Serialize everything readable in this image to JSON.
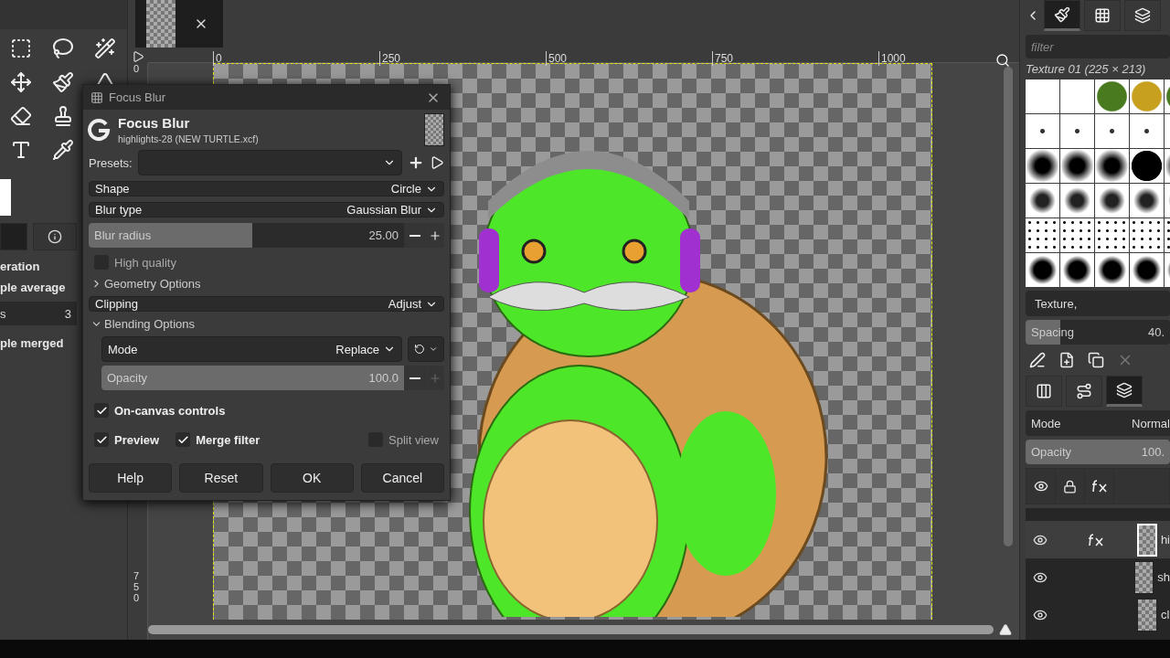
{
  "tool_options": [
    {
      "kind": "heading",
      "text": "eration"
    },
    {
      "kind": "label",
      "text": "ple average"
    },
    {
      "kind": "spin",
      "label": "s",
      "value": "3"
    },
    {
      "kind": "label",
      "text": "ple merged"
    }
  ],
  "rulers": {
    "horizontal": [
      "0",
      "250",
      "500",
      "750",
      "1000"
    ],
    "vertical": [
      "0",
      "750"
    ]
  },
  "dialog": {
    "window_title": "Focus Blur",
    "title": "Focus Blur",
    "subtitle": "highlights-28 (NEW TURTLE.xcf)",
    "presets_label": "Presets:",
    "rows": [
      {
        "kind": "combo",
        "label": "Shape",
        "value": "Circle"
      },
      {
        "kind": "combo",
        "label": "Blur type",
        "value": "Gaussian Blur"
      },
      {
        "kind": "slider",
        "label": "Blur radius",
        "value": "25.00",
        "level": 0.52
      },
      {
        "kind": "check",
        "label": "High quality",
        "checked": false
      },
      {
        "kind": "expander",
        "label": "Geometry Options",
        "expanded": false
      },
      {
        "kind": "combo",
        "label": "Clipping",
        "value": "Adjust"
      },
      {
        "kind": "expander",
        "label": "Blending Options",
        "expanded": true
      }
    ],
    "blending": {
      "mode_label": "Mode",
      "mode": "Replace",
      "opacity": {
        "label": "Opacity",
        "value": "100.0",
        "level": 1
      }
    },
    "on_canvas": {
      "label": "On-canvas controls",
      "checked": true
    },
    "preview": {
      "label": "Preview",
      "checked": true
    },
    "merge": {
      "label": "Merge filter",
      "checked": true
    },
    "split": {
      "label": "Split view",
      "checked": false
    },
    "buttons": [
      "Help",
      "Reset",
      "OK",
      "Cancel"
    ]
  },
  "brushes_panel": {
    "tabs": [
      {
        "selected": true
      },
      {
        "selected": false
      },
      {
        "selected": false
      }
    ],
    "filter_placeholder": "filter",
    "brush_name": "Texture 01 (225 × 213)",
    "tags": "Texture,",
    "spacing": {
      "label": "Spacing",
      "value": "40.",
      "level": 0.24
    }
  },
  "layers_panel": {
    "tabs": [
      {
        "selected": false
      },
      {
        "selected": false
      },
      {
        "selected": true
      }
    ],
    "mode_label": "Mode",
    "mode": "Normal",
    "opacity": {
      "label": "Opacity",
      "value": "100.",
      "level": 1
    },
    "layers": [
      {
        "name": "hi",
        "selected": true,
        "effects": true
      },
      {
        "name": "sh",
        "selected": false,
        "effects": false
      },
      {
        "name": "cl",
        "selected": false,
        "effects": false
      }
    ]
  }
}
